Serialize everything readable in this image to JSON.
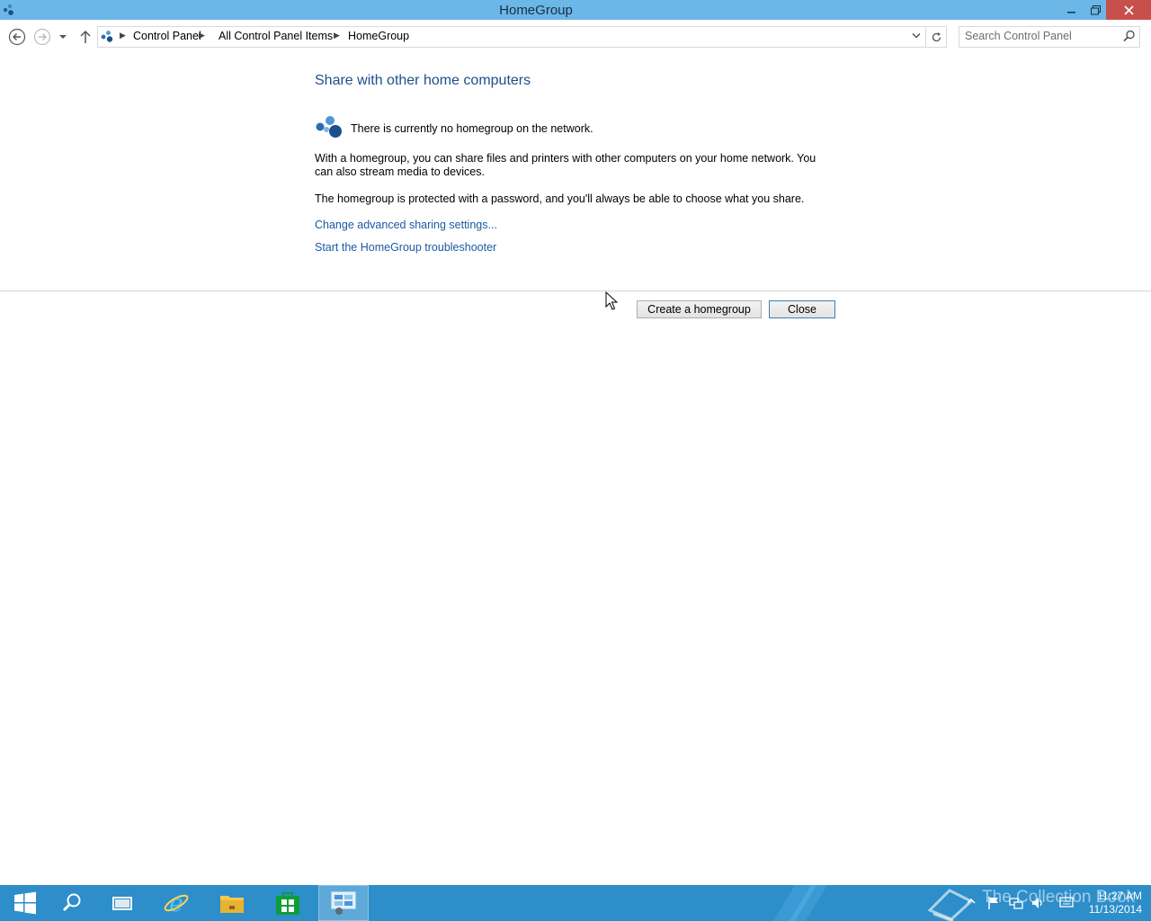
{
  "window": {
    "title": "HomeGroup"
  },
  "address": {
    "segments": [
      "Control Panel",
      "All Control Panel Items",
      "HomeGroup"
    ]
  },
  "search": {
    "placeholder": "Search Control Panel"
  },
  "content": {
    "heading": "Share with other home computers",
    "status": "There is currently no homegroup on the network.",
    "para1": "With a homegroup, you can share files and printers with other computers on your home network. You can also stream media to devices.",
    "para2": "The homegroup is protected with a password, and you'll always be able to choose what you share.",
    "link_advanced": "Change advanced sharing settings...",
    "link_troubleshooter": "Start the HomeGroup troubleshooter"
  },
  "buttons": {
    "create": "Create a homegroup",
    "close": "Close"
  },
  "taskbar": {
    "watermark": "The Collection Book",
    "time": "11:27 AM",
    "date": "11/13/2014",
    "items": [
      "start-icon",
      "search-icon",
      "task-view-icon",
      "internet-explorer-icon",
      "file-explorer-icon",
      "store-icon",
      "control-panel-icon"
    ]
  },
  "colors": {
    "titlebar": "#6ab7e8",
    "taskbar": "#2d8ec9",
    "link": "#1a5aa6",
    "heading": "#1e4e8c",
    "close_button": "#c7504b"
  }
}
